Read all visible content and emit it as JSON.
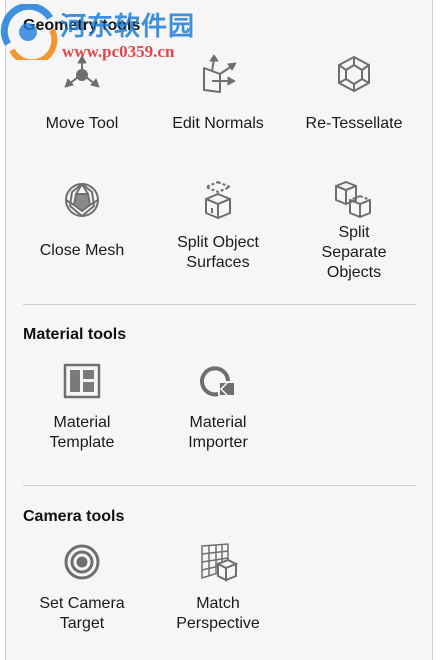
{
  "watermark": {
    "site_name": "河东软件园",
    "url": "www.pc0359.cn"
  },
  "sections": {
    "geometry": {
      "title": "Geometry tools",
      "tools": {
        "move_tool": "Move Tool",
        "edit_normals": "Edit Normals",
        "retessellate": "Re-Tessellate",
        "close_mesh": "Close Mesh",
        "split_object_surfaces": [
          "Split Object",
          "Surfaces"
        ],
        "split_separate_objects": [
          "Split",
          "Separate",
          "Objects"
        ]
      }
    },
    "material": {
      "title": "Material tools",
      "tools": {
        "material_template": [
          "Material",
          "Template"
        ],
        "material_importer": [
          "Material",
          "Importer"
        ]
      }
    },
    "camera": {
      "title": "Camera tools",
      "tools": {
        "set_camera_target": [
          "Set Camera",
          "Target"
        ],
        "match_perspective": [
          "Match",
          "Perspective"
        ]
      }
    }
  },
  "icons": {
    "move_tool": "move-arrows-icon",
    "edit_normals": "normals-icon",
    "retessellate": "tessellate-cube-icon",
    "close_mesh": "mesh-sphere-icon",
    "split_object_surfaces": "split-surfaces-icon",
    "split_separate_objects": "split-objects-icon",
    "material_template": "template-icon",
    "material_importer": "importer-icon",
    "set_camera_target": "target-icon",
    "match_perspective": "perspective-grid-icon"
  },
  "colors": {
    "icon_gray": "#6e6e6e",
    "panel_bg": "#f6f6f6",
    "watermark_blue": "#1e7fd8",
    "watermark_red": "#e0333a"
  }
}
